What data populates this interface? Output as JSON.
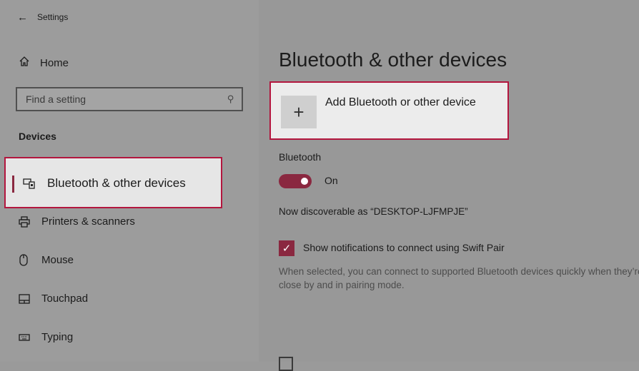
{
  "window": {
    "title": "Settings"
  },
  "sidebar": {
    "home_label": "Home",
    "search_placeholder": "Find a setting",
    "section_title": "Devices",
    "items": [
      {
        "label": "Bluetooth & other devices",
        "icon": "bluetooth-devices-icon",
        "active": true
      },
      {
        "label": "Printers & scanners",
        "icon": "printer-icon"
      },
      {
        "label": "Mouse",
        "icon": "mouse-icon"
      },
      {
        "label": "Touchpad",
        "icon": "touchpad-icon"
      },
      {
        "label": "Typing",
        "icon": "keyboard-icon"
      }
    ]
  },
  "main": {
    "title": "Bluetooth & other devices",
    "add_device_label": "Add Bluetooth or other device",
    "bluetooth_label": "Bluetooth",
    "bluetooth_state": "On",
    "discoverable_text": "Now discoverable as “DESKTOP-LJFMPJE”",
    "swift_pair_label": "Show notifications to connect using Swift Pair",
    "swift_pair_checked": true,
    "swift_pair_description": "When selected, you can connect to supported Bluetooth devices quickly when they’re close by and in pairing mode."
  },
  "colors": {
    "accent": "#8a2840",
    "highlight_border": "#b3163e"
  }
}
